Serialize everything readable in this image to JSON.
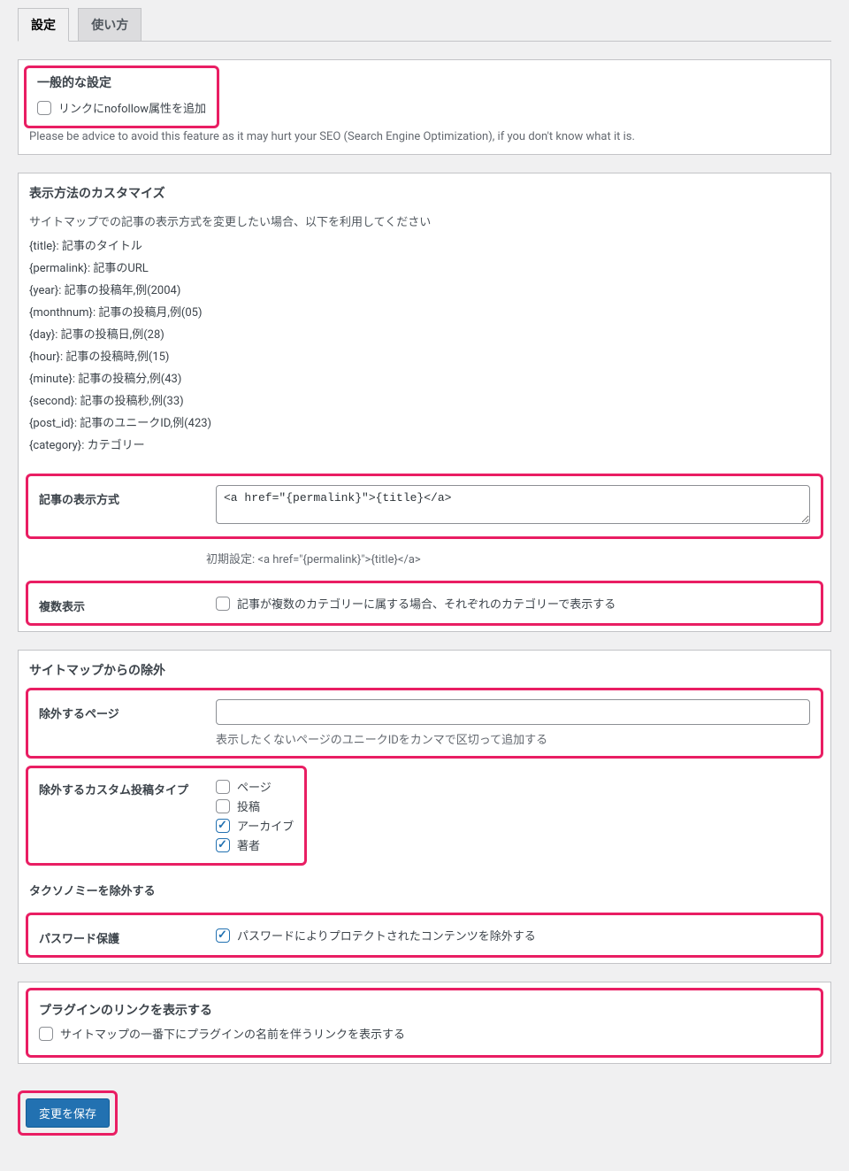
{
  "tabs": {
    "settings": "設定",
    "usage": "使い方"
  },
  "general": {
    "heading": "一般的な設定",
    "nofollow_label": "リンクにnofollow属性を追加",
    "nofollow_note": "Please be advice to avoid this feature as it may hurt your SEO (Search Engine Optimization), if you don't know what it is."
  },
  "display": {
    "heading": "表示方法のカスタマイズ",
    "intro": "サイトマップでの記事の表示方式を変更したい場合、以下を利用してください",
    "ph_title": "{title}: 記事のタイトル",
    "ph_permalink": "{permalink}: 記事のURL",
    "ph_year": "{year}: 記事の投稿年,例(2004)",
    "ph_monthnum": "{monthnum}: 記事の投稿月,例(05)",
    "ph_day": "{day}: 記事の投稿日,例(28)",
    "ph_hour": "{hour}: 記事の投稿時,例(15)",
    "ph_minute": "{minute}: 記事の投稿分,例(43)",
    "ph_second": "{second}: 記事の投稿秒,例(33)",
    "ph_postid": "{post_id}: 記事のユニークID,例(423)",
    "ph_category": "{category}: カテゴリー",
    "format_label": "記事の表示方式",
    "format_value": "<a href=\"{permalink}\">{title}</a>",
    "format_default": "初期設定: <a href=\"{permalink}\">{title}</a>",
    "multi_label": "複数表示",
    "multi_checkbox": "記事が複数のカテゴリーに属する場合、それぞれのカテゴリーで表示する"
  },
  "exclude": {
    "heading": "サイトマップからの除外",
    "pages_label": "除外するページ",
    "pages_value": "",
    "pages_note": "表示したくないページのユニークIDをカンマで区切って追加する",
    "cpt_label": "除外するカスタム投稿タイプ",
    "cpt_page": "ページ",
    "cpt_post": "投稿",
    "cpt_archive": "アーカイブ",
    "cpt_author": "著者",
    "tax_label": "タクソノミーを除外する",
    "pw_label": "パスワード保護",
    "pw_checkbox": "パスワードによりプロテクトされたコンテンツを除外する"
  },
  "pluginlink": {
    "heading": "プラグインのリンクを表示する",
    "checkbox": "サイトマップの一番下にプラグインの名前を伴うリンクを表示する"
  },
  "submit": "変更を保存"
}
